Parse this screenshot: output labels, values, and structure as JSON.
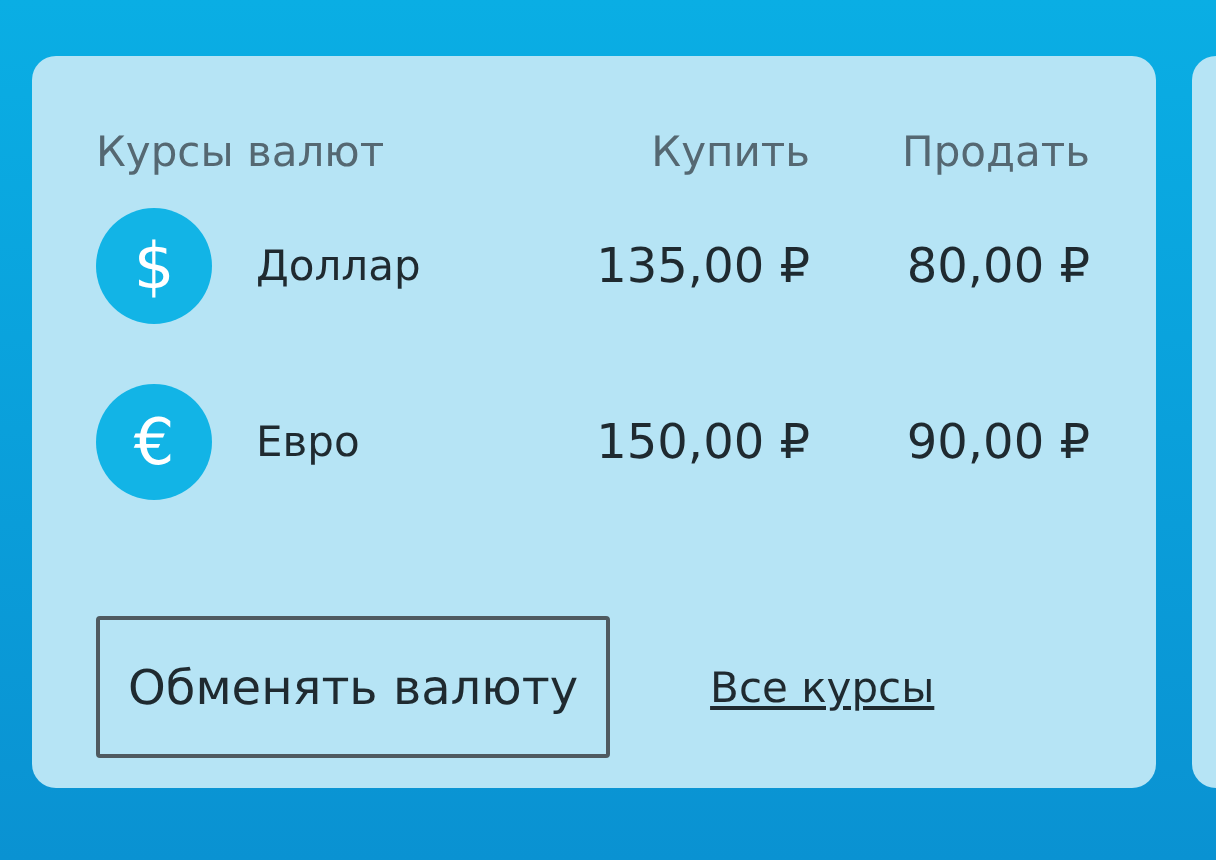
{
  "card": {
    "title": "Курсы валют",
    "columns": [
      "Купить",
      "Продать"
    ],
    "rows": [
      {
        "symbol": "$",
        "name": "Доллар",
        "buy": "135,00 ₽",
        "sell": "80,00 ₽"
      },
      {
        "symbol": "€",
        "name": "Евро",
        "buy": "150,00 ₽",
        "sell": "90,00 ₽"
      }
    ],
    "exchange_button": "Обменять валюту",
    "all_rates_link": "Все курсы"
  }
}
